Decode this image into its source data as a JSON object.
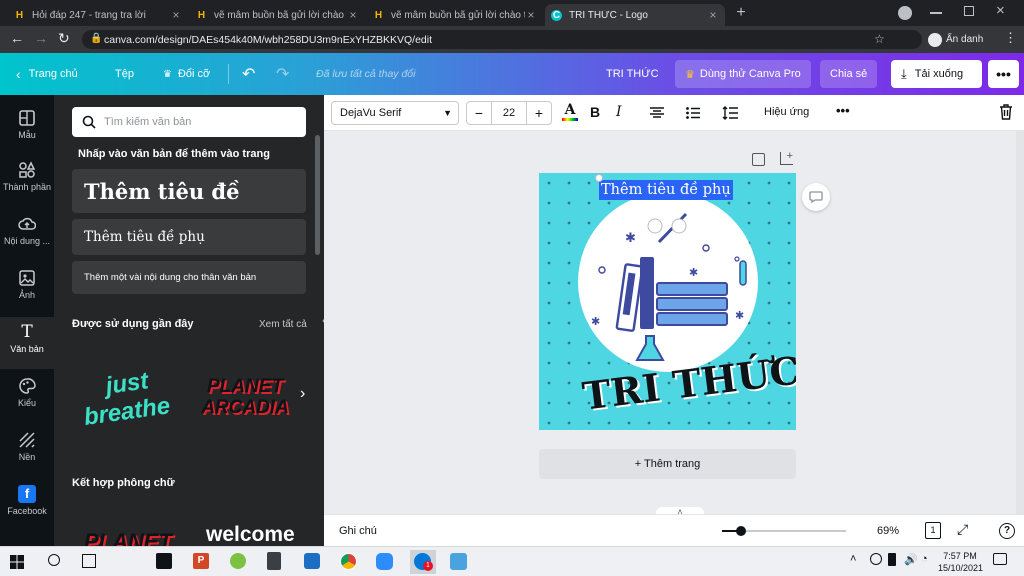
{
  "browser": {
    "tabs": [
      {
        "title": "Hỏi đáp 247 - trang tra lời",
        "favicon": "H"
      },
      {
        "title": "vẽ mâm buồn bã gửi lời chào tạ",
        "favicon": "H"
      },
      {
        "title": "vẽ mâm buồn bã gửi lời chào tạ",
        "favicon": "H"
      },
      {
        "title": "TRI THỨC - Logo",
        "favicon": "C"
      }
    ],
    "new_tab": "+",
    "url": "canva.com/design/DAEs454k40M/wbh258DU3m9nExYHZBKKVQ/edit",
    "profile": "Ẩn danh"
  },
  "topbar": {
    "home": "Trang chủ",
    "file": "Tệp",
    "resize": "Đổi cỡ",
    "saved_status": "Đã lưu tất cả thay đổi",
    "design_title": "TRI THỨC",
    "try_pro": "Dùng thử Canva Pro",
    "share": "Chia sẻ",
    "download": "Tải xuống"
  },
  "rail": {
    "items": [
      "Mẫu",
      "Thành phần",
      "Nội dung ...",
      "Ảnh",
      "Văn bản",
      "Kiểu",
      "Nền",
      "Facebook"
    ]
  },
  "panel": {
    "search_placeholder": "Tìm kiếm văn bản",
    "click_hint": "Nhấp vào văn bản để thêm vào trang",
    "heading": "Thêm tiêu đề",
    "subheading": "Thêm tiêu đề phụ",
    "body": "Thêm một vài nội dung cho thân văn bản",
    "recent_title": "Được sử dụng gần đây",
    "see_all": "Xem tất cả",
    "recent_1": "just breathe",
    "recent_2_line1": "PLANET",
    "recent_2_line2": "ARCADIA",
    "combos_title": "Kết hợp phông chữ",
    "combo_1": "PLANET",
    "combo_2": "welcome"
  },
  "editor_toolbar": {
    "font": "DejaVu Serif",
    "font_size": "22",
    "effects": "Hiệu ứng"
  },
  "canvas": {
    "subtitle_text": "Thêm tiêu đề phụ",
    "logo_text": "TRI THỨC",
    "add_page": "+ Thêm trang",
    "design_bg": "#4fd6e3"
  },
  "footer": {
    "notes": "Ghi chú",
    "zoom_percent": "69%",
    "zoom_level": 0.15,
    "page_count": "1"
  },
  "taskbar": {
    "time": "7:57 PM",
    "date": "15/10/2021",
    "zoom_badge": "1"
  }
}
